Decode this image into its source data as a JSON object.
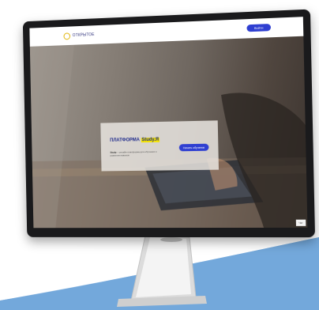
{
  "site": {
    "logo_text": "ОТКРЫТОЕ",
    "header_button": "Войти"
  },
  "hero": {
    "title_part1": "ПЛАТФОРМА",
    "title_highlight": "Study.Я",
    "desc_bold": "Study",
    "desc_rest": " – онлайн-платформа для обучения и развития навыков",
    "cta": "Начать обучение"
  },
  "chat": {
    "label": "Чат"
  },
  "colors": {
    "accent": "#2f3fd1",
    "highlight": "#f5e400",
    "title": "#1f2b8c",
    "swoosh": "#7aaedf"
  },
  "icons": {
    "logo": "circle-logo-icon"
  }
}
